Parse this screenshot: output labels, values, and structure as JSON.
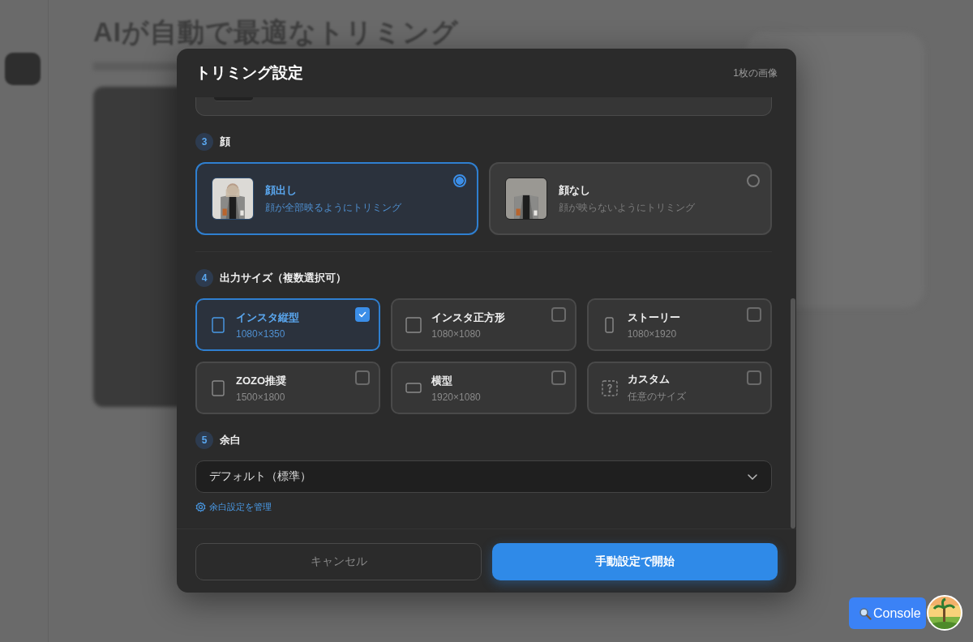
{
  "background": {
    "heading": "AIが自動で最適なトリミング"
  },
  "dialog": {
    "title": "トリミング設定",
    "image_count": "1枚の画像",
    "face_section": {
      "number": "3",
      "label": "顔",
      "options": [
        {
          "title": "顔出し",
          "description": "顔が全部映るようにトリミング",
          "selected": true
        },
        {
          "title": "顔なし",
          "description": "顔が映らないようにトリミング",
          "selected": false
        }
      ]
    },
    "size_section": {
      "number": "4",
      "label": "出力サイズ（複数選択可）",
      "options": [
        {
          "title": "インスタ縦型",
          "size": "1080×1350",
          "kind": "portrait",
          "checked": true
        },
        {
          "title": "インスタ正方形",
          "size": "1080×1080",
          "kind": "square",
          "checked": false
        },
        {
          "title": "ストーリー",
          "size": "1080×1920",
          "kind": "tall",
          "checked": false
        },
        {
          "title": "ZOZO推奨",
          "size": "1500×1800",
          "kind": "portrait",
          "checked": false
        },
        {
          "title": "横型",
          "size": "1920×1080",
          "kind": "wide",
          "checked": false
        },
        {
          "title": "カスタム",
          "size": "任意のサイズ",
          "kind": "custom",
          "checked": false
        }
      ]
    },
    "margin_section": {
      "number": "5",
      "label": "余白",
      "select": {
        "value": "デフォルト（標準）"
      },
      "manage_link": "余白設定を管理"
    },
    "buttons": [
      {
        "label": "キャンセル",
        "kind": "secondary"
      },
      {
        "label": "手動設定で開始",
        "kind": "primary"
      }
    ]
  },
  "console_button": {
    "label": "Console"
  }
}
